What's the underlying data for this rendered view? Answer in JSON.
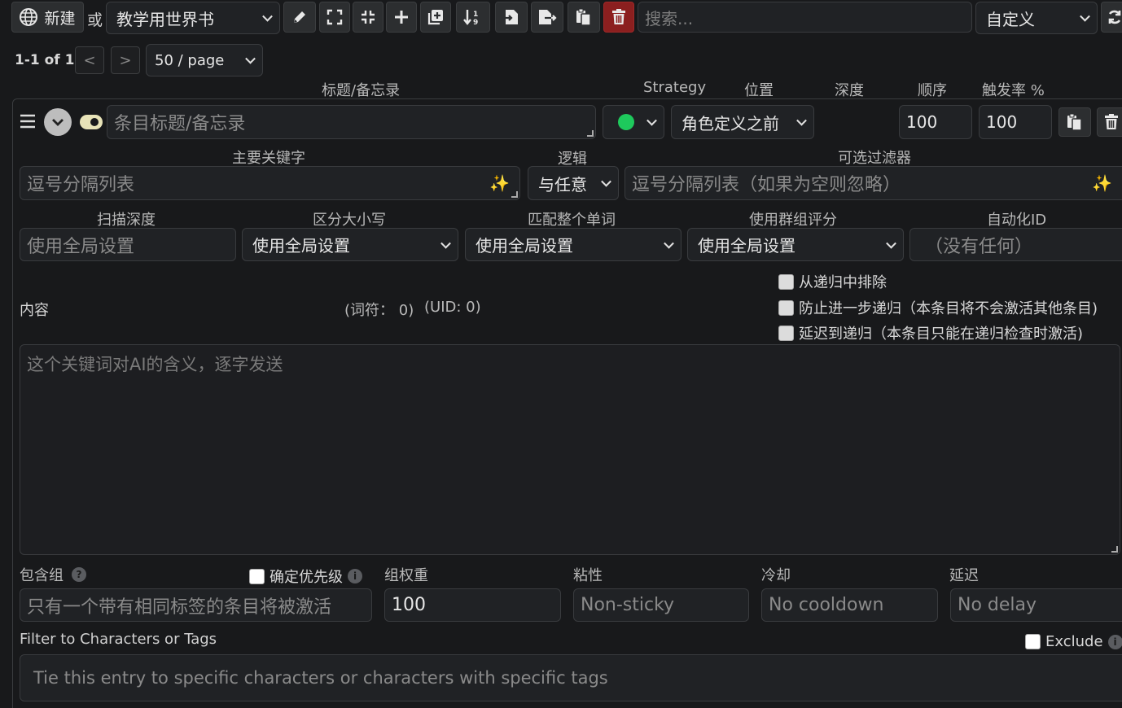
{
  "toolbar": {
    "new_label": "新建",
    "or_label": "或",
    "worldbook_select": "教学用世界书",
    "search_placeholder": "搜索...",
    "sort_select": "自定义"
  },
  "pagination": {
    "range_text": "1-1 of 1",
    "prev": "<",
    "next": ">",
    "page_size": "50 / page"
  },
  "headers": {
    "title_memo": "标题/备忘录",
    "strategy": "Strategy",
    "position": "位置",
    "depth": "深度",
    "order": "顺序",
    "trigger_rate": "触发率 %"
  },
  "entry": {
    "title_placeholder": "条目标题/备忘录",
    "position_select": "角色定义之前",
    "order_value": "100",
    "trigger_value": "100",
    "primary_keys_label": "主要关键字",
    "primary_keys_placeholder": "逗号分隔列表",
    "logic_label": "逻辑",
    "logic_select": "与任意",
    "optional_filter_label": "可选过滤器",
    "optional_filter_placeholder": "逗号分隔列表（如果为空则忽略）",
    "scan_depth_label": "扫描深度",
    "scan_depth_placeholder": "使用全局设置",
    "case_label": "区分大小写",
    "case_select": "使用全局设置",
    "whole_word_label": "匹配整个单词",
    "whole_word_select": "使用全局设置",
    "group_score_label": "使用群组评分",
    "group_score_select": "使用全局设置",
    "automation_label": "自动化ID",
    "automation_placeholder": "（没有任何）",
    "exclude_recursion": "从递归中排除",
    "prevent_recursion": "防止进一步递归（本条目将不会激活其他条目)",
    "delay_recursion": "延迟到递归（本条目只能在递归检查时激活)",
    "content_label": "内容",
    "token_count": "(词符： 0)",
    "uid": "(UID: 0)",
    "content_placeholder": "这个关键词对AI的含义，逐字发送",
    "inclusion_group_label": "包含组",
    "prioritize_label": "确定优先级",
    "group_weight_label": "组权重",
    "sticky_label": "粘性",
    "cooldown_label": "冷却",
    "delay_label": "延迟",
    "inclusion_group_placeholder": "只有一个带有相同标签的条目将被激活",
    "group_weight_value": "100",
    "sticky_placeholder": "Non-sticky",
    "cooldown_placeholder": "No cooldown",
    "delay_placeholder": "No delay",
    "filter_chars_label": "Filter to Characters or Tags",
    "exclude_label": "Exclude",
    "filter_chars_placeholder": "Tie this entry to specific characters or characters with specific tags"
  },
  "colors": {
    "status_dot": "#1ec95c",
    "delete_button": "#8b1f1f",
    "toggle": "#e8e3b8"
  },
  "icons": [
    "globe-icon",
    "pencil-icon",
    "expand-icon",
    "collapse-icon",
    "plus-icon",
    "duplicate-icon",
    "sort-icon",
    "import-icon",
    "export-icon",
    "copy-icon",
    "trash-icon",
    "refresh-icon",
    "menu-icon",
    "chevron-down-icon",
    "toggle-icon",
    "sparkle-icon",
    "help-icon",
    "info-icon"
  ]
}
